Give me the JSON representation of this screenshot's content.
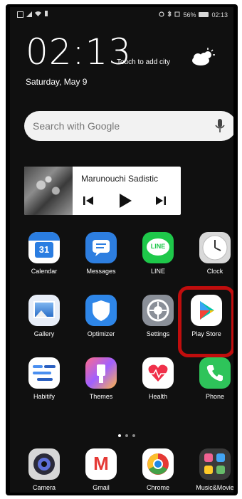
{
  "status_bar": {
    "battery": "56%",
    "time": "02:13"
  },
  "clock_widget": {
    "time": "02:13",
    "touch_to_add_city": "Touch to add city",
    "date": "Saturday, May 9",
    "weather_icon": "partly-cloudy-icon"
  },
  "search": {
    "placeholder": "Search with Google",
    "mic_icon": "mic-icon"
  },
  "music_widget": {
    "title": "Marunouchi Sadistic",
    "controls": [
      "previous-icon",
      "play-icon",
      "next-icon"
    ]
  },
  "apps_row1": [
    {
      "label": "Calendar",
      "icon": "calendar-icon",
      "badge": "31"
    },
    {
      "label": "Messages",
      "icon": "messages-icon"
    },
    {
      "label": "LINE",
      "icon": "line-icon",
      "badge": "LINE"
    },
    {
      "label": "Clock",
      "icon": "clock-icon"
    }
  ],
  "apps_row2": [
    {
      "label": "Gallery",
      "icon": "gallery-icon"
    },
    {
      "label": "Optimizer",
      "icon": "optimizer-icon"
    },
    {
      "label": "Settings",
      "icon": "settings-icon"
    },
    {
      "label": "Play Store",
      "icon": "play-store-icon"
    }
  ],
  "apps_row3": [
    {
      "label": "Habitify",
      "icon": "habitify-icon"
    },
    {
      "label": "Themes",
      "icon": "themes-icon"
    },
    {
      "label": "Health",
      "icon": "health-icon"
    },
    {
      "label": "Phone",
      "icon": "phone-icon"
    }
  ],
  "dock": [
    {
      "label": "Camera",
      "icon": "camera-icon"
    },
    {
      "label": "Gmail",
      "icon": "gmail-icon",
      "badge": "M"
    },
    {
      "label": "Chrome",
      "icon": "chrome-icon"
    },
    {
      "label": "Music&Movie",
      "icon": "music-movie-folder-icon"
    }
  ],
  "colors": {
    "highlight": "#c00d0d",
    "background": "#101010"
  }
}
